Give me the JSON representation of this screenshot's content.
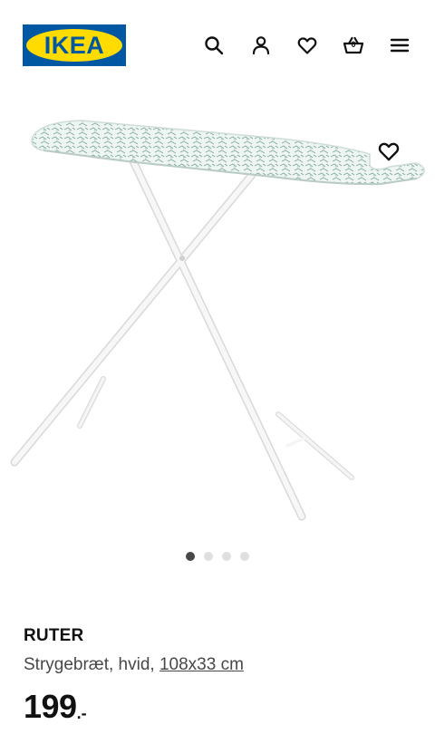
{
  "header": {
    "logo_text": "IKEA",
    "icons": [
      "search-icon",
      "user-icon",
      "heart-icon",
      "basket-icon",
      "menu-icon"
    ],
    "basket_count": "0"
  },
  "gallery": {
    "image_alt": "RUTER",
    "dots_count": 4,
    "active_dot": 0
  },
  "product": {
    "name": "RUTER",
    "description_prefix": "Strygebræt, hvid, ",
    "size": "108x33 cm",
    "price_integer": "199",
    "price_suffix": ".-"
  },
  "colors": {
    "ikea_blue": "#0058a3",
    "ikea_yellow": "#ffdb00",
    "text": "#111111",
    "muted_text": "#484848",
    "dot_active": "#484848",
    "dot_inactive": "#dfdfdf"
  }
}
